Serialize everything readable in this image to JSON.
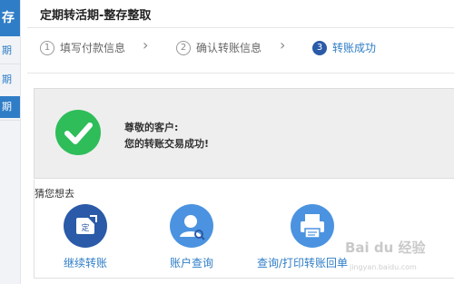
{
  "sidebar": {
    "top_label": "存",
    "items": [
      "期",
      "期",
      "期"
    ]
  },
  "header": {
    "title": "定期转活期-整存整取"
  },
  "steps": [
    {
      "num": "1",
      "label": "填写付款信息"
    },
    {
      "num": "2",
      "label": "确认转账信息"
    },
    {
      "num": "3",
      "label": "转账成功"
    }
  ],
  "result": {
    "greeting": "尊敬的客户:",
    "message": "您的转账交易成功!"
  },
  "suggestions": {
    "title": "猜您想去",
    "actions": [
      {
        "label": "继续转账",
        "icon": "continue-transfer-icon",
        "badge": "定"
      },
      {
        "label": "账户查询",
        "icon": "user-query-icon"
      },
      {
        "label": "查询/打印转账回单",
        "icon": "printer-icon"
      }
    ]
  },
  "watermark": {
    "text": "Bai du 经验",
    "url": "jingyan.baidu.com"
  },
  "colors": {
    "primary": "#2f7dc7",
    "dark_icon": "#2a5aa8",
    "light_icon": "#4b93e0",
    "success": "#2ebd59"
  }
}
